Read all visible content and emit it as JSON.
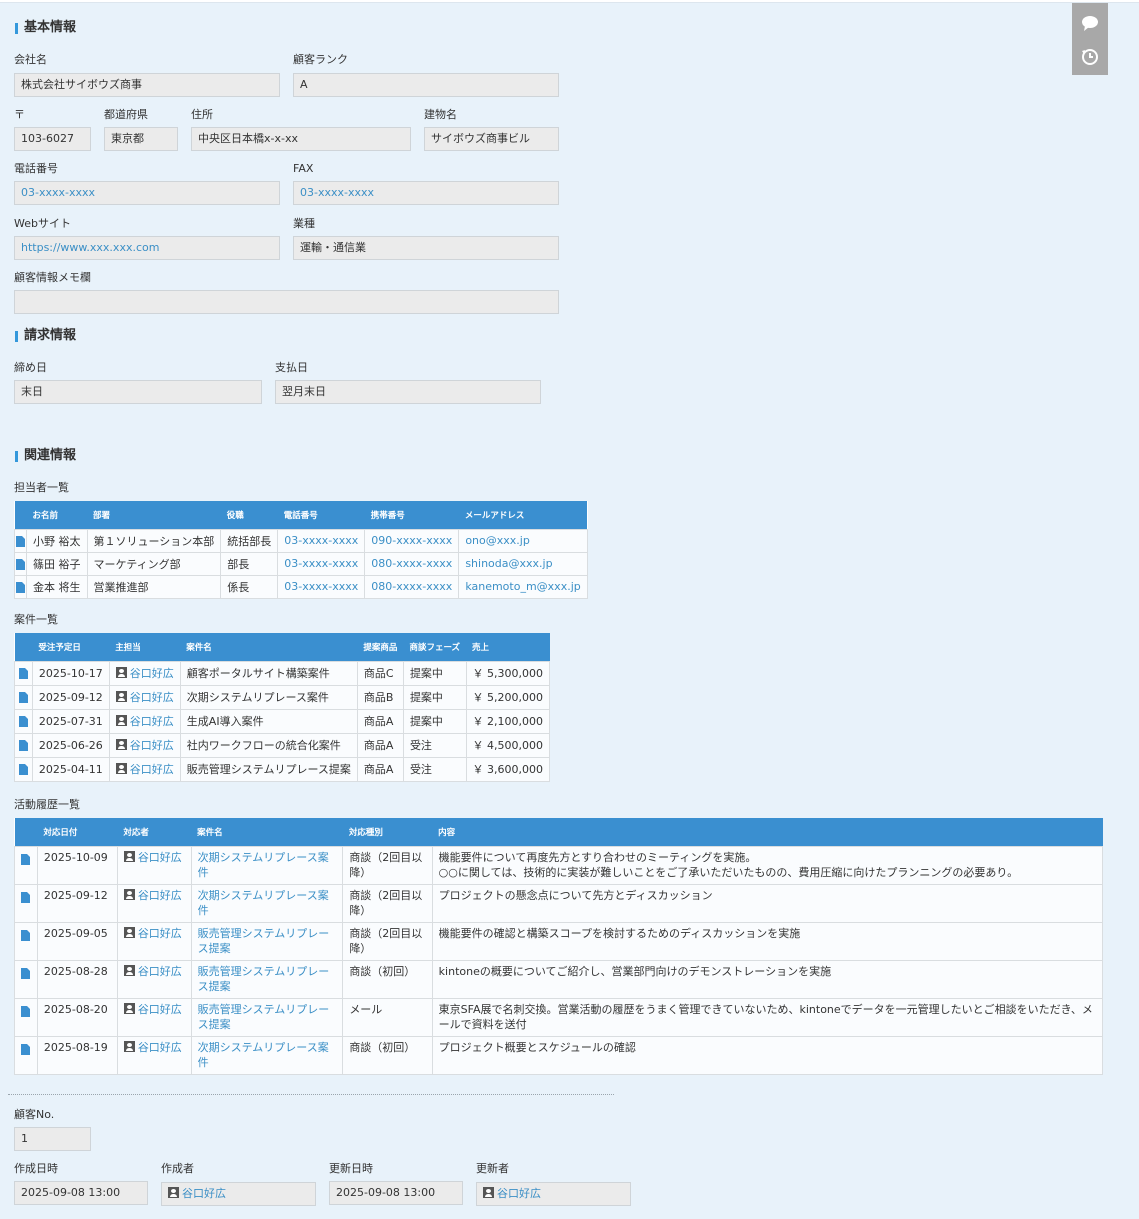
{
  "basic": {
    "title": "基本情報",
    "company_label": "会社名",
    "company": "株式会社サイボウズ商事",
    "rank_label": "顧客ランク",
    "rank": "A",
    "zip_label": "〒",
    "zip": "103-6027",
    "pref_label": "都道府県",
    "pref": "東京都",
    "address_label": "住所",
    "address": "中央区日本橋x-x-xx",
    "building_label": "建物名",
    "building": "サイボウズ商事ビル",
    "tel_label": "電話番号",
    "tel": "03-xxxx-xxxx",
    "fax_label": "FAX",
    "fax": "03-xxxx-xxxx",
    "web_label": "Webサイト",
    "web": "https://www.xxx.xxx.com",
    "industry_label": "業種",
    "industry": "運輸・通信業",
    "memo_label": "顧客情報メモ欄",
    "memo": ""
  },
  "billing": {
    "title": "請求情報",
    "closing_label": "締め日",
    "closing": "末日",
    "payment_label": "支払日",
    "payment": "翌月末日"
  },
  "related": {
    "title": "関連情報"
  },
  "contacts": {
    "title": "担当者一覧",
    "headers": [
      "お名前",
      "部署",
      "役職",
      "電話番号",
      "携帯番号",
      "メールアドレス"
    ],
    "rows": [
      [
        "小野 裕太",
        "第１ソリューション本部",
        "統括部長",
        "03-xxxx-xxxx",
        "090-xxxx-xxxx",
        "ono@xxx.jp"
      ],
      [
        "篠田 裕子",
        "マーケティング部",
        "部長",
        "03-xxxx-xxxx",
        "080-xxxx-xxxx",
        "shinoda@xxx.jp"
      ],
      [
        "金本 将生",
        "営業推進部",
        "係長",
        "03-xxxx-xxxx",
        "080-xxxx-xxxx",
        "kanemoto_m@xxx.jp"
      ]
    ]
  },
  "deals": {
    "title": "案件一覧",
    "headers": [
      "受注予定日",
      "主担当",
      "案件名",
      "提案商品",
      "商談フェーズ",
      "売上"
    ],
    "rows": [
      [
        "2025-10-17",
        "谷口好広",
        "顧客ポータルサイト構築案件",
        "商品C",
        "提案中",
        "￥ 5,300,000"
      ],
      [
        "2025-09-12",
        "谷口好広",
        "次期システムリプレース案件",
        "商品B",
        "提案中",
        "￥ 5,200,000"
      ],
      [
        "2025-07-31",
        "谷口好広",
        "生成AI導入案件",
        "商品A",
        "提案中",
        "￥ 2,100,000"
      ],
      [
        "2025-06-26",
        "谷口好広",
        "社内ワークフローの統合化案件",
        "商品A",
        "受注",
        "￥ 4,500,000"
      ],
      [
        "2025-04-11",
        "谷口好広",
        "販売管理システムリプレース提案",
        "商品A",
        "受注",
        "￥ 3,600,000"
      ]
    ]
  },
  "activities": {
    "title": "活動履歴一覧",
    "headers": [
      "対応日付",
      "対応者",
      "案件名",
      "対応種別",
      "内容"
    ],
    "rows": [
      [
        "2025-10-09",
        "谷口好広",
        "次期システムリプレース案件",
        "商談（2回目以降）",
        "機能要件について再度先方とすり合わせのミーティングを実施。\n○○に関しては、技術的に実装が難しいことをご了承いただいたものの、費用圧縮に向けたプランニングの必要あり。"
      ],
      [
        "2025-09-12",
        "谷口好広",
        "次期システムリプレース案件",
        "商談（2回目以降）",
        "プロジェクトの懸念点について先方とディスカッション"
      ],
      [
        "2025-09-05",
        "谷口好広",
        "販売管理システムリプレース提案",
        "商談（2回目以降）",
        "機能要件の確認と構築スコープを検討するためのディスカッションを実施"
      ],
      [
        "2025-08-28",
        "谷口好広",
        "販売管理システムリプレース提案",
        "商談（初回）",
        "kintoneの概要についてご紹介し、営業部門向けのデモンストレーションを実施"
      ],
      [
        "2025-08-20",
        "谷口好広",
        "販売管理システムリプレース提案",
        "メール",
        "東京SFA展で名刺交換。営業活動の履歴をうまく管理できていないため、kintoneでデータを一元管理したいとご相談をいただき、メールで資料を送付"
      ],
      [
        "2025-08-19",
        "谷口好広",
        "次期システムリプレース案件",
        "商談（初回）",
        "プロジェクト概要とスケジュールの確認"
      ]
    ]
  },
  "meta": {
    "no_label": "顧客No.",
    "no": "1",
    "created_at_label": "作成日時",
    "created_at": "2025-09-08 13:00",
    "creator_label": "作成者",
    "creator": "谷口好広",
    "updated_at_label": "更新日時",
    "updated_at": "2025-09-08 13:00",
    "updater_label": "更新者",
    "updater": "谷口好広"
  },
  "icons": {
    "sidebar": [
      "comment-icon",
      "history-icon"
    ],
    "row": "document-icon",
    "user": "user-icon"
  },
  "colors": {
    "accent": "#3a8fd0",
    "link": "#3b8fc6",
    "background": "#e8f2fa"
  }
}
